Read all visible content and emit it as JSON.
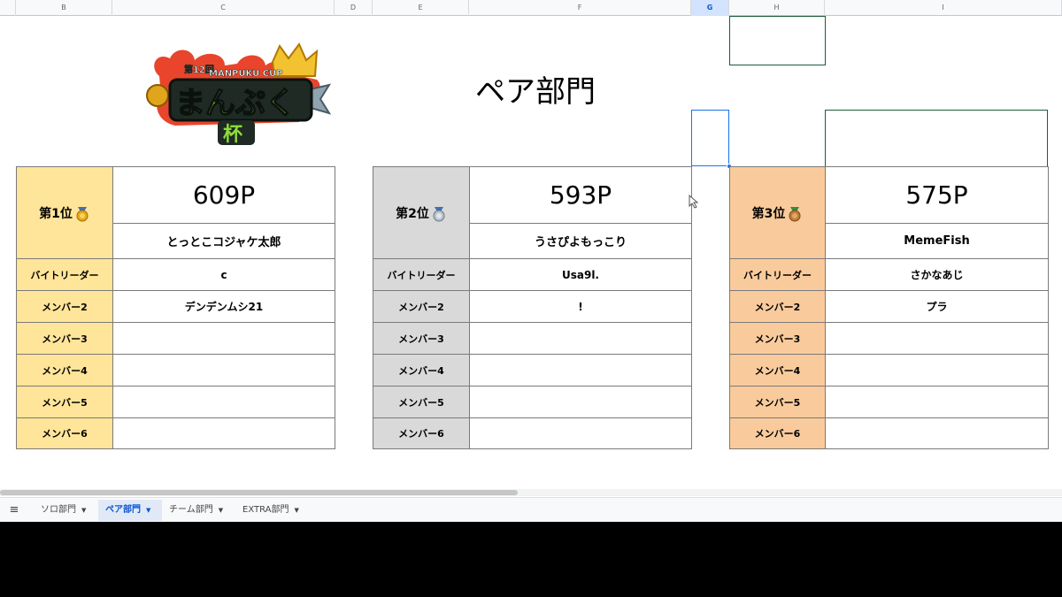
{
  "columns": [
    {
      "letter": "B"
    },
    {
      "letter": "C"
    },
    {
      "letter": "D"
    },
    {
      "letter": "E"
    },
    {
      "letter": "F"
    },
    {
      "letter": "G"
    },
    {
      "letter": "H"
    },
    {
      "letter": "I"
    }
  ],
  "logo": {
    "edition": "第12回",
    "cup_text": "MANPUKU CUP",
    "name_text": "まんぷく",
    "kanji": "杯"
  },
  "title": "ペア部門",
  "row_labels": {
    "leader": "バイトリーダー",
    "member2": "メンバー2",
    "member3": "メンバー3",
    "member4": "メンバー4",
    "member5": "メンバー5",
    "member6": "メンバー6"
  },
  "rankings": [
    {
      "place": "第1位",
      "points": "609P",
      "team": "とっとこコジャケ太郎",
      "leader": "c",
      "member2": "デンデンムシ21",
      "member3": "",
      "member4": "",
      "member5": "",
      "member6": "",
      "label_color": "#ffe599",
      "medal_color": "#e6a817",
      "medal_icon": "gold-medal-icon"
    },
    {
      "place": "第2位",
      "points": "593P",
      "team": "うさぴよもっこり",
      "leader": "Usa9l.",
      "member2": "!",
      "member3": "",
      "member4": "",
      "member5": "",
      "member6": "",
      "label_color": "#d9d9d9",
      "medal_color": "#9aa7b3",
      "medal_icon": "silver-medal-icon"
    },
    {
      "place": "第3位",
      "points": "575P",
      "team": "MemeFish",
      "leader": "さかなあじ",
      "member2": "プラ",
      "member3": "",
      "member4": "",
      "member5": "",
      "member6": "",
      "label_color": "#f9cb9c",
      "medal_color": "#c27c3a",
      "medal_icon": "bronze-medal-icon"
    }
  ],
  "tabs": [
    {
      "label": "ソロ部門",
      "active": false
    },
    {
      "label": "ペア部門",
      "active": true
    },
    {
      "label": "チーム部門",
      "active": false
    },
    {
      "label": "EXTRA部門",
      "active": false
    }
  ],
  "colors": {
    "grid_border": "#7a7a7a",
    "selection": "#1a73e8",
    "box_border": "#1e5b3a"
  }
}
